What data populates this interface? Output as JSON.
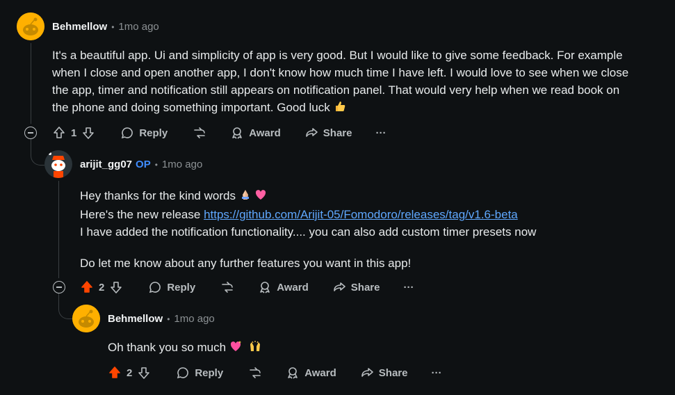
{
  "comments": [
    {
      "username": "Behmellow",
      "time": "1mo ago",
      "body": [
        "It's a beautiful app. Ui and simplicity of app is very good. But I would like to give some feedback. For example",
        "when I close and open another app, I don't know how much time I have left. I would love to see when we close",
        "the app, timer and notification still appears on notification panel. That would very help when we read book on",
        "the phone and doing something important. Good luck"
      ],
      "votes": "1",
      "reply": "Reply",
      "award": "Award",
      "share": "Share",
      "more": "···"
    },
    {
      "username": "arijit_gg07",
      "op_badge": "OP",
      "time": "1mo ago",
      "line1": "Hey thanks for the kind words",
      "line2_prefix": "Here's the new release",
      "link": "https://github.com/Arijit-05/Fomodoro/releases/tag/v1.6-beta",
      "line3": "I have added the notification functionality.... you can also add custom timer presets now",
      "line4": "Do let me know about any further features you want in this app!",
      "votes": "2",
      "reply": "Reply",
      "award": "Award",
      "share": "Share",
      "more": "···"
    },
    {
      "username": "Behmellow",
      "time": "1mo ago",
      "body": "Oh thank you so much",
      "votes": "2",
      "reply": "Reply",
      "award": "Award",
      "share": "Share",
      "more": "···"
    }
  ],
  "colors": {
    "background": "#0e1113",
    "upvoted": "#ff4500",
    "link": "#5fa8ff",
    "op": "#3f8cff",
    "avatar": "#ffb000"
  },
  "icons": [
    "upvote-icon",
    "downvote-icon",
    "comment-icon",
    "crosspost-icon",
    "award-icon",
    "share-icon",
    "collapse-icon",
    "thumbs-up-emoji",
    "praying-hands-emoji",
    "heart-emoji",
    "sparkling-heart-emoji",
    "raised-hands-emoji"
  ]
}
